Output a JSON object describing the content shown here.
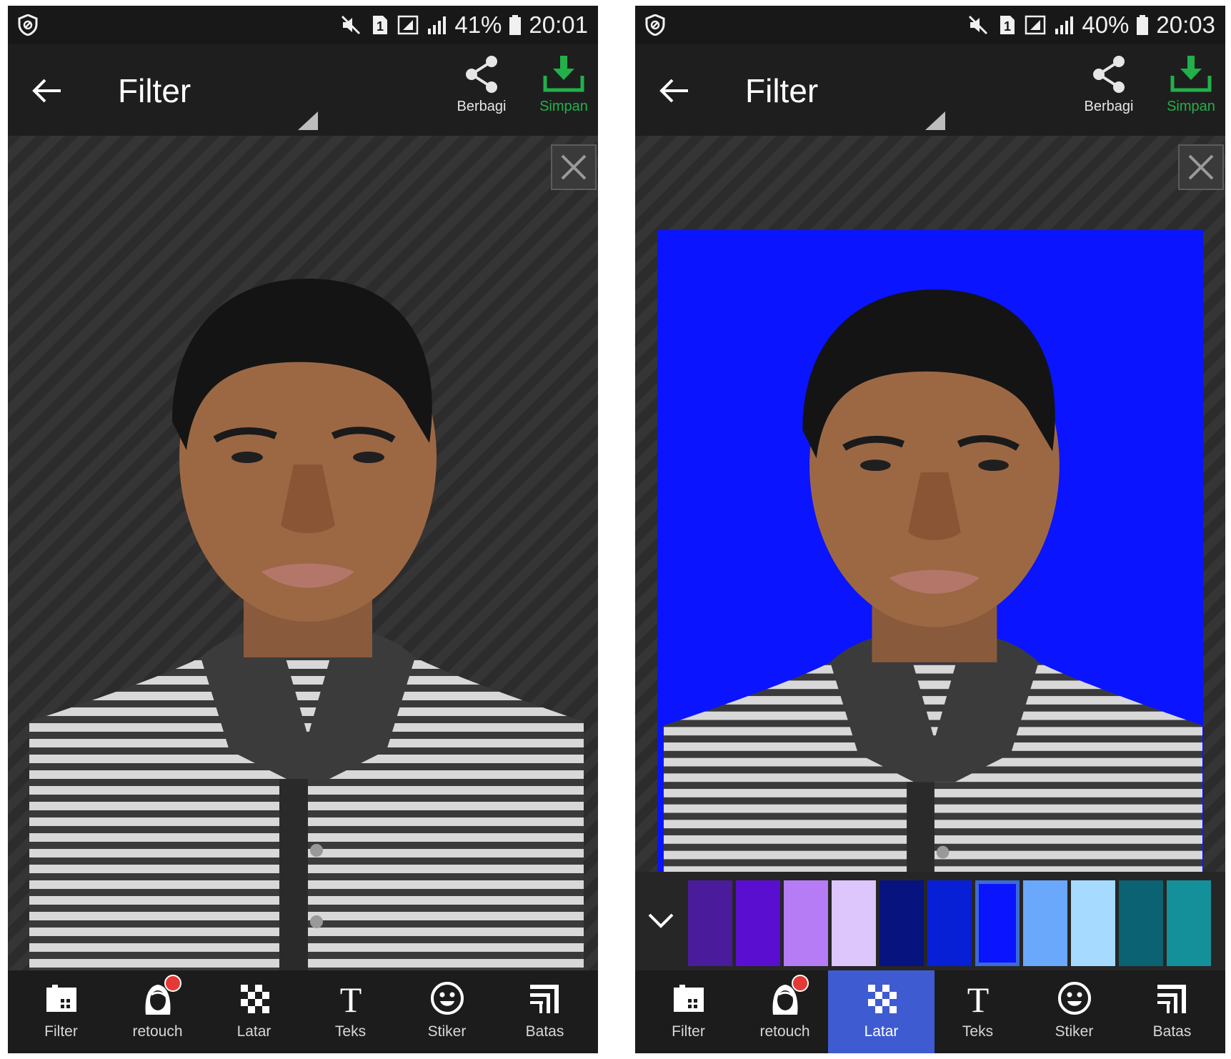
{
  "screens": [
    {
      "status_bar": {
        "battery": "41%",
        "time": "20:01"
      },
      "toolbar": {
        "title": "Filter",
        "share_label": "Berbagi",
        "save_label": "Simpan"
      },
      "background_applied": "none",
      "bottom_nav": [
        {
          "label": "Filter",
          "icon": "filter-icon",
          "active": false
        },
        {
          "label": "retouch",
          "icon": "retouch-icon",
          "active": false
        },
        {
          "label": "Latar",
          "icon": "background-checker-icon",
          "active": false
        },
        {
          "label": "Teks",
          "icon": "text-icon",
          "active": false
        },
        {
          "label": "Stiker",
          "icon": "smiley-icon",
          "active": false
        },
        {
          "label": "Batas",
          "icon": "frame-icon",
          "active": false
        }
      ]
    },
    {
      "status_bar": {
        "battery": "40%",
        "time": "20:03"
      },
      "toolbar": {
        "title": "Filter",
        "share_label": "Berbagi",
        "save_label": "Simpan"
      },
      "background_applied": "#0a14ff",
      "swatches": [
        {
          "color": "#4a1b9a",
          "selected": false
        },
        {
          "color": "#5a0fd0",
          "selected": false
        },
        {
          "color": "#b57cf6",
          "selected": false
        },
        {
          "color": "#dcc6fb",
          "selected": false
        },
        {
          "color": "#07137e",
          "selected": false
        },
        {
          "color": "#0720d6",
          "selected": false
        },
        {
          "color": "#0a14ff",
          "selected": true
        },
        {
          "color": "#6aa8fb",
          "selected": false
        },
        {
          "color": "#a6daff",
          "selected": false
        },
        {
          "color": "#0a6272",
          "selected": false
        },
        {
          "color": "#13909a",
          "selected": false
        }
      ],
      "bottom_nav": [
        {
          "label": "Filter",
          "icon": "filter-icon",
          "active": false
        },
        {
          "label": "retouch",
          "icon": "retouch-icon",
          "active": false
        },
        {
          "label": "Latar",
          "icon": "background-checker-icon",
          "active": true
        },
        {
          "label": "Teks",
          "icon": "text-icon",
          "active": false
        },
        {
          "label": "Stiker",
          "icon": "smiley-icon",
          "active": false
        },
        {
          "label": "Batas",
          "icon": "frame-icon",
          "active": false
        }
      ]
    }
  ],
  "colors": {
    "save_accent": "#22b04a",
    "active_tab": "#3f5bd1",
    "badge": "#e53935"
  }
}
